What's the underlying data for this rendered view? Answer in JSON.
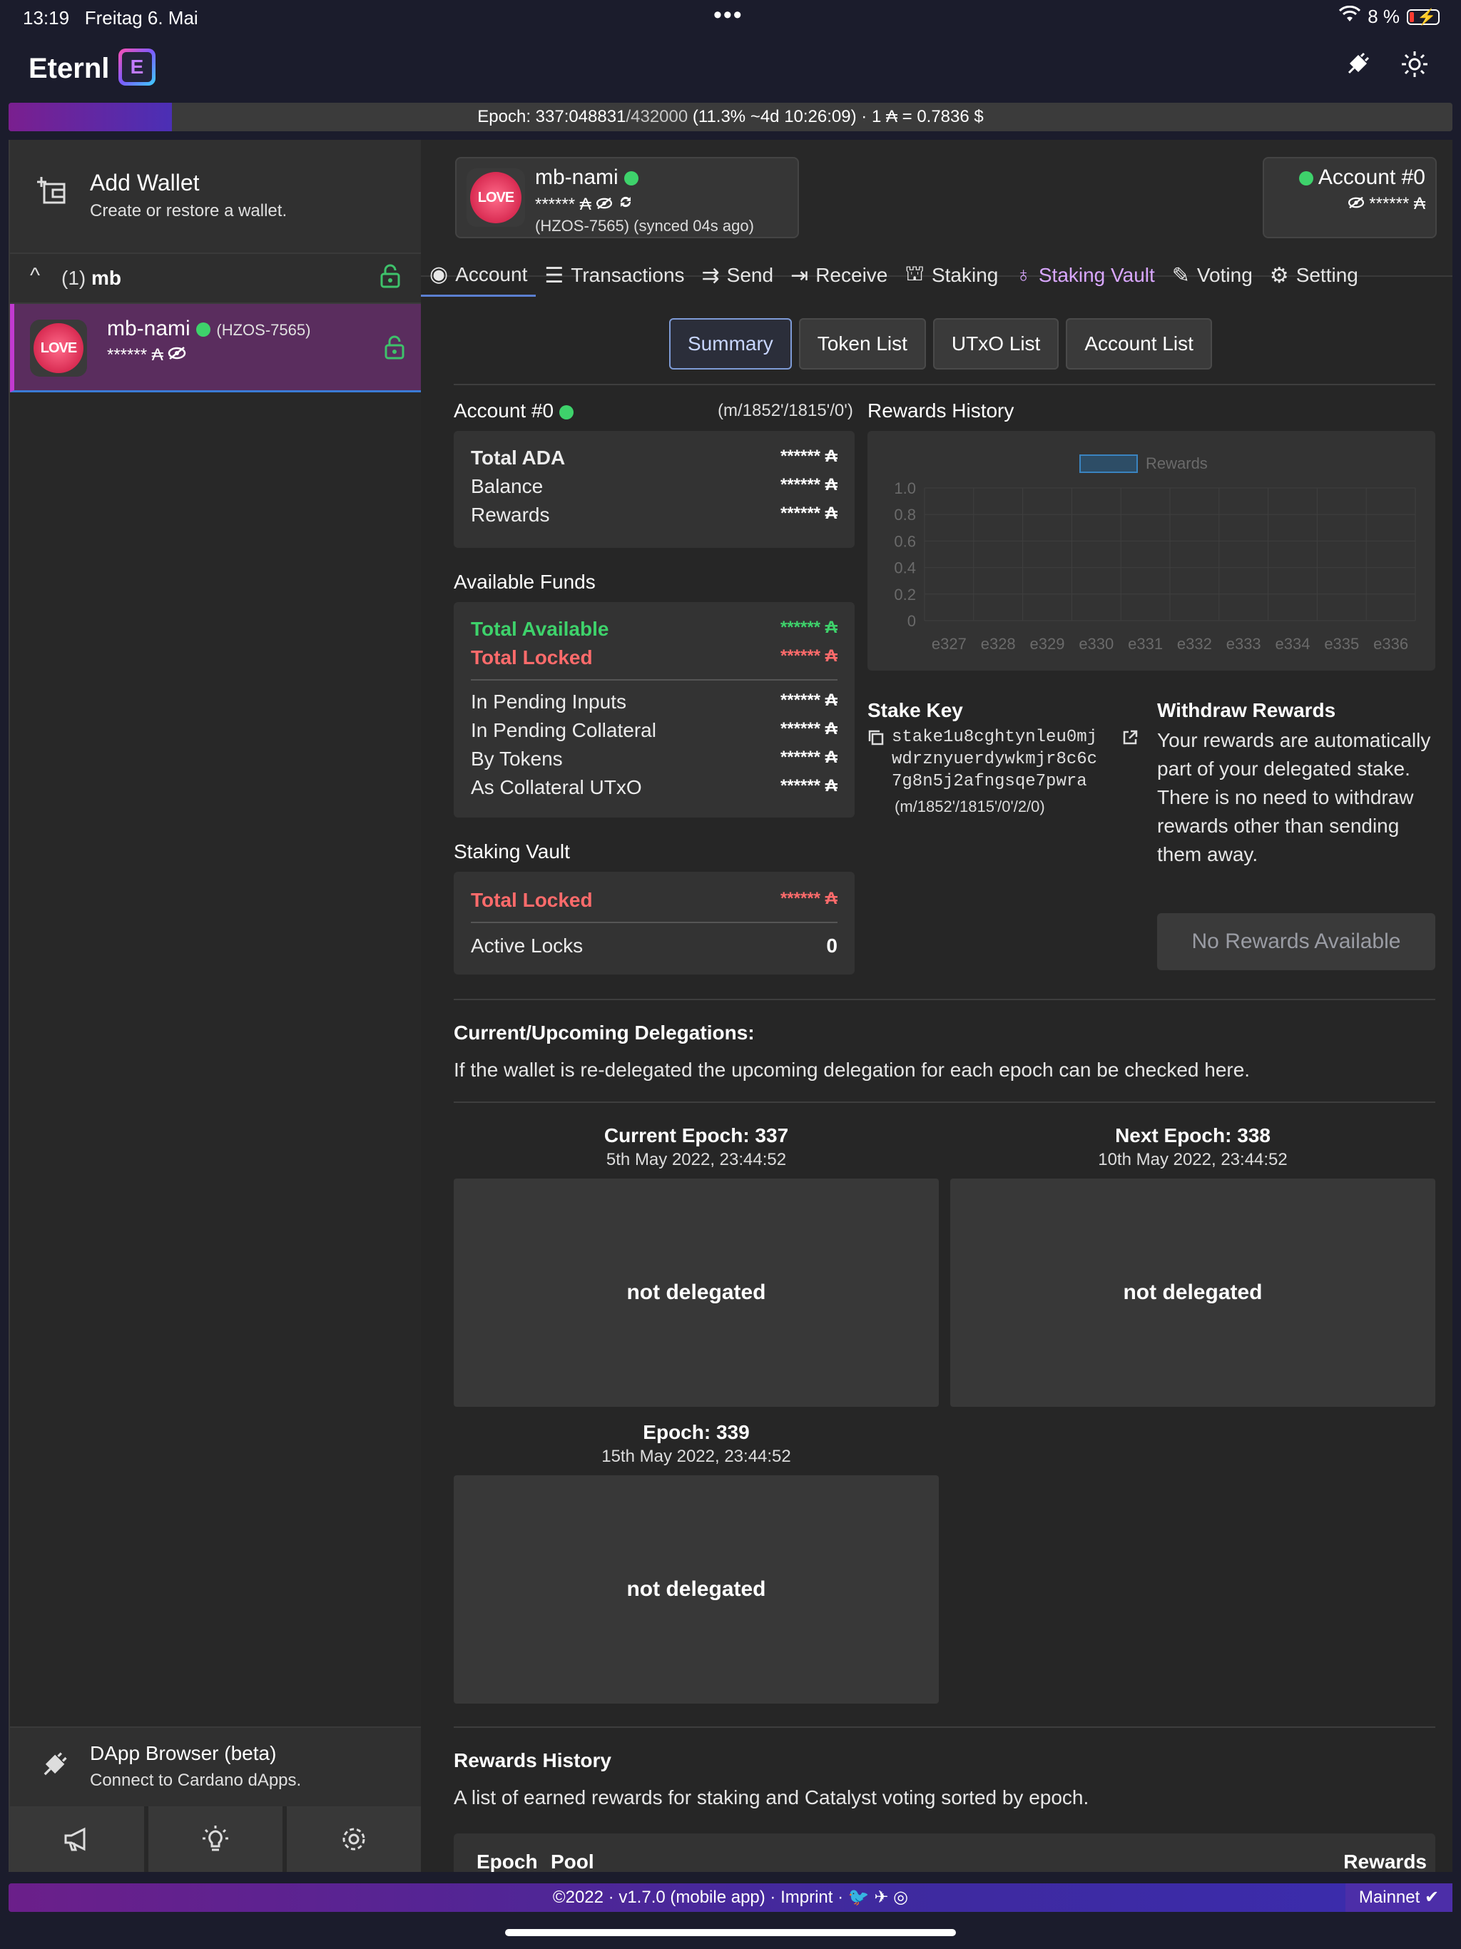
{
  "status": {
    "time": "13:19",
    "date": "Freitag 6. Mai",
    "battery": "8 %"
  },
  "app": {
    "name": "Eternl",
    "logo_letter": "E",
    "icons": [
      "plug-icon",
      "sun-icon"
    ]
  },
  "epoch": {
    "label": "Epoch: 337:048831",
    "total": "/432000",
    "progress_text": " (11.3% ~4d 10:26:09) · 1 ₳ = 0.7836 $",
    "progress": 0.113
  },
  "sidebar": {
    "add_wallet": {
      "title": "Add Wallet",
      "subtitle": "Create or restore a wallet."
    },
    "group": {
      "count": "(1)",
      "name": "mb"
    },
    "wallet": {
      "name": "mb-nami",
      "id": "(HZOS-7565)",
      "balance": "****** ₳",
      "avatar": "LOVE"
    },
    "dapp": {
      "title": "DApp Browser (beta)",
      "subtitle": "Connect to Cardano dApps."
    }
  },
  "wallet_card": {
    "name": "mb-nami",
    "balance": "****** ₳",
    "sync": "(HZOS-7565) (synced 04s ago)"
  },
  "account_card": {
    "name": "Account #0",
    "balance": "****** ₳"
  },
  "tabs": [
    {
      "label": "Account",
      "icon": "eye-icon"
    },
    {
      "label": "Transactions",
      "icon": "list-icon"
    },
    {
      "label": "Send",
      "icon": "send-icon"
    },
    {
      "label": "Receive",
      "icon": "receive-icon"
    },
    {
      "label": "Staking",
      "icon": "staking-icon"
    },
    {
      "label": "Staking Vault",
      "icon": "vault-icon"
    },
    {
      "label": "Voting",
      "icon": "voting-icon"
    },
    {
      "label": "Setting",
      "icon": "settings-icon"
    }
  ],
  "subtabs": [
    "Summary",
    "Token List",
    "UTxO List",
    "Account List"
  ],
  "account": {
    "title": "Account #0",
    "path": "(m/1852'/1815'/0')",
    "total_ada": "Total ADA",
    "balance": "Balance",
    "rewards": "Rewards",
    "value": "****** ₳"
  },
  "funds": {
    "title": "Available Funds",
    "total_available": "Total Available",
    "total_locked": "Total Locked",
    "pending_inputs": "In Pending Inputs",
    "pending_collateral": "In Pending Collateral",
    "by_tokens": "By Tokens",
    "as_collateral": "As Collateral UTxO",
    "value": "****** ₳"
  },
  "vault": {
    "title": "Staking Vault",
    "total_locked": "Total Locked",
    "value": "****** ₳",
    "active_locks": "Active Locks",
    "active_locks_value": "0"
  },
  "rewards_chart_title": "Rewards History",
  "chart_data": {
    "type": "bar",
    "categories": [
      "e327",
      "e328",
      "e329",
      "e330",
      "e331",
      "e332",
      "e333",
      "e334",
      "e335",
      "e336"
    ],
    "series": [
      {
        "name": "Rewards",
        "values": [
          0,
          0,
          0,
          0,
          0,
          0,
          0,
          0,
          0,
          0
        ]
      }
    ],
    "yticks": [
      "1.0",
      "0.8",
      "0.6",
      "0.4",
      "0.2",
      "0"
    ],
    "ylim": [
      0,
      1
    ],
    "legend": "top"
  },
  "stake": {
    "title": "Stake Key",
    "key_line1": "stake1u8cghtynleu0mj",
    "key_line2": "wdrznyuerdywkmjr8c6c",
    "key_line3": "7g8n5j2afngsqe7pwra",
    "path": "(m/1852'/1815'/0'/2/0)"
  },
  "withdraw": {
    "title": "Withdraw Rewards",
    "text": "Your rewards are automatically part of your delegated stake. There is no need to withdraw rewards other than sending them away.",
    "button": "No Rewards Available"
  },
  "delegations": {
    "title": "Current/Upcoming Delegations:",
    "text": "If the wallet is re-delegated the upcoming delegation for each epoch can be checked here.",
    "epochs": [
      {
        "label": "Current Epoch: 337",
        "date": "5th May 2022, 23:44:52",
        "status": "not delegated"
      },
      {
        "label": "Next Epoch: 338",
        "date": "10th May 2022, 23:44:52",
        "status": "not delegated"
      },
      {
        "label": "Epoch: 339",
        "date": "15th May 2022, 23:44:52",
        "status": "not delegated"
      }
    ]
  },
  "rewards_history": {
    "title": "Rewards History",
    "text": "A list of earned rewards for staking and Catalyst voting sorted by epoch.",
    "columns": [
      "Epoch",
      "Pool",
      "Rewards"
    ]
  },
  "footer": {
    "text": "©2022 · v1.7.0 (mobile app) · Imprint ·",
    "network": "Mainnet"
  }
}
